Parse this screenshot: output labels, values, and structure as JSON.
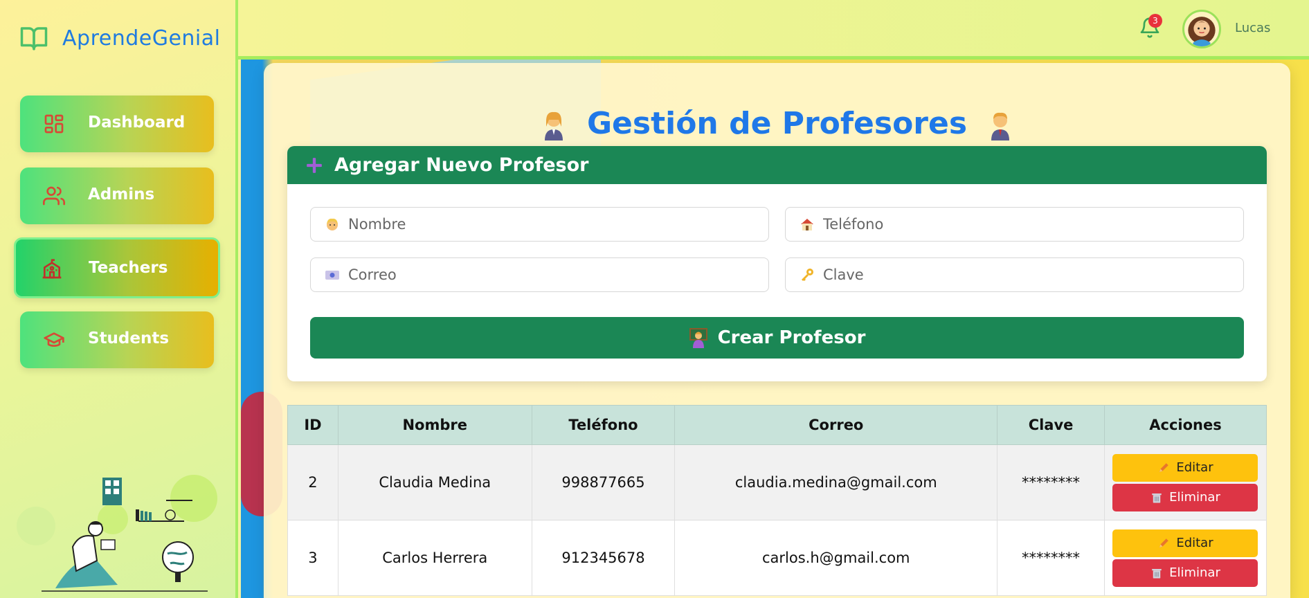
{
  "colors": {
    "accent": "#1f78e8",
    "primary_green": "#1b8755",
    "edit_yellow": "#fec20d",
    "delete_red": "#dd3545",
    "badge_red": "#e8323c"
  },
  "brand": {
    "name": "AprendeGenial",
    "icon": "book-open-icon"
  },
  "sidebar": {
    "items": [
      {
        "label": "Dashboard",
        "icon": "dashboard-grid-icon",
        "active": false
      },
      {
        "label": "Admins",
        "icon": "users-icon",
        "active": false
      },
      {
        "label": "Teachers",
        "icon": "school-icon",
        "active": true
      },
      {
        "label": "Students",
        "icon": "graduation-cap-icon",
        "active": false
      }
    ]
  },
  "header": {
    "notifications_count": "3",
    "user_name": "Lucas"
  },
  "page": {
    "title": "Gestión de Profesores"
  },
  "form": {
    "heading": "Agregar Nuevo Profesor",
    "fields": {
      "nombre": {
        "placeholder": "Nombre",
        "value": "",
        "icon": "person-emoji-icon"
      },
      "telefono": {
        "placeholder": "Teléfono",
        "value": "",
        "icon": "house-emoji-icon"
      },
      "correo": {
        "placeholder": "Correo",
        "value": "",
        "icon": "id-card-emoji-icon"
      },
      "clave": {
        "placeholder": "Clave",
        "value": "",
        "icon": "key-emoji-icon"
      }
    },
    "submit_label": "Crear Profesor"
  },
  "table": {
    "headers": [
      "ID",
      "Nombre",
      "Teléfono",
      "Correo",
      "Clave",
      "Acciones"
    ],
    "rows": [
      {
        "id": "2",
        "nombre": "Claudia Medina",
        "telefono": "998877665",
        "correo": "claudia.medina@gmail.com",
        "clave": "********"
      },
      {
        "id": "3",
        "nombre": "Carlos Herrera",
        "telefono": "912345678",
        "correo": "carlos.h@gmail.com",
        "clave": "********"
      }
    ],
    "edit_label": "Editar",
    "delete_label": "Eliminar"
  }
}
